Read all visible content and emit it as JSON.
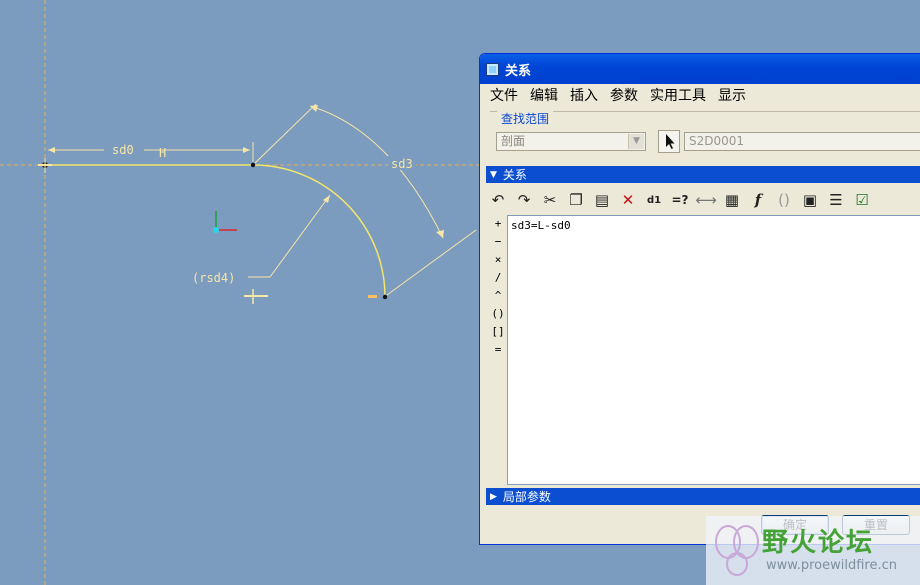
{
  "sketch": {
    "dim_sd0": "sd0",
    "dim_H": "H",
    "dim_sd3": "sd3",
    "dim_rsd4": "(rsd4)"
  },
  "dialog": {
    "title": "关系",
    "menu": [
      "文件",
      "编辑",
      "插入",
      "参数",
      "实用工具",
      "显示"
    ],
    "search": {
      "legend": "查找范围",
      "scope_value": "剖面",
      "entity_value": "S2D0001"
    },
    "relations_label": "关系",
    "operators": [
      "+",
      "−",
      "×",
      "/",
      "^",
      "()",
      "[]",
      "="
    ],
    "editor_text": "sd3=L-sd0",
    "local_params_label": "局部参数",
    "ok_label": "确定",
    "reset_label": "重置"
  },
  "toolbar_icons": [
    "undo-icon",
    "redo-icon",
    "cut-icon",
    "copy-icon",
    "paste-icon",
    "delete-icon",
    "toggle-display-icon",
    "evaluate-icon",
    "measure-icon",
    "sort-icon",
    "function-icon",
    "parentheses-icon",
    "lock-icon",
    "list-icon",
    "verify-icon"
  ],
  "watermark": {
    "brand": "野火论坛",
    "url": "www.proewildfire.cn"
  },
  "colors": {
    "background": "#7b9bbf",
    "sketch_line": "#f2e66a",
    "dimension": "#f7e6a6",
    "section_bar": "#0b4fd0"
  }
}
